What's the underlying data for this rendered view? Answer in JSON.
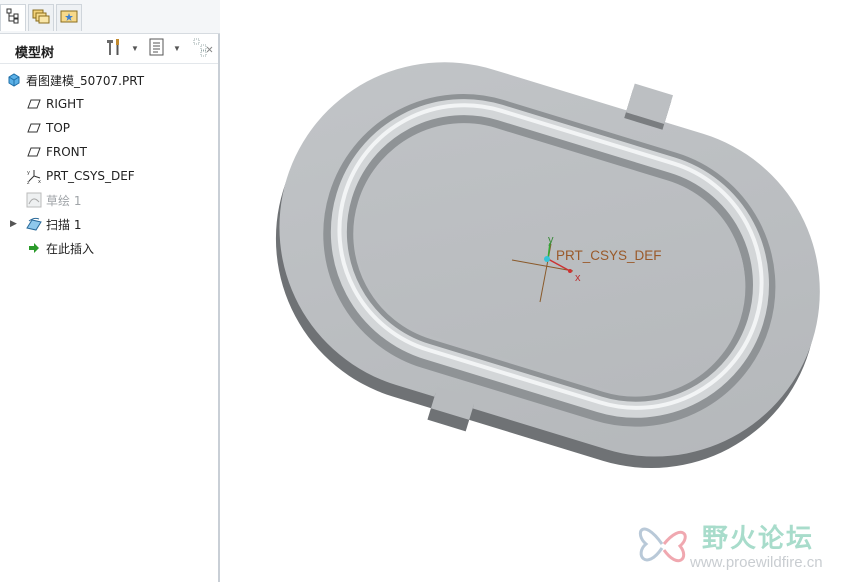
{
  "panel_tabs": [
    {
      "icon": "model-tree-icon",
      "active": true
    },
    {
      "icon": "folder-browser-icon",
      "active": false
    },
    {
      "icon": "favorites-icon",
      "active": false
    }
  ],
  "tree_toolbar": {
    "title": "模型树",
    "settings_icon": "tools-icon",
    "show_icon": "list-settings-icon",
    "filter_icon": "tree-filter-icon"
  },
  "tree": {
    "root": {
      "label": "看图建模_50707.PRT",
      "icon": "part-icon"
    },
    "items": [
      {
        "label": "RIGHT",
        "icon": "datum-plane-icon",
        "disabled": false
      },
      {
        "label": "TOP",
        "icon": "datum-plane-icon",
        "disabled": false
      },
      {
        "label": "FRONT",
        "icon": "datum-plane-icon",
        "disabled": false
      },
      {
        "label": "PRT_CSYS_DEF",
        "icon": "csys-icon",
        "disabled": false
      },
      {
        "label": "草绘 1",
        "icon": "sketch-icon",
        "disabled": true
      },
      {
        "label": "扫描 1",
        "icon": "sweep-icon",
        "disabled": false,
        "expandable": true
      },
      {
        "label": "在此插入",
        "icon": "insert-here-arrow-icon",
        "disabled": false
      }
    ]
  },
  "viewport": {
    "csys_label": "PRT_CSYS_DEF",
    "axis_x": "x",
    "axis_y": "y",
    "model_color": "#b9bcbf"
  },
  "watermark": {
    "text_cn": "野火论坛",
    "url": "www.proewildfire.cn"
  }
}
